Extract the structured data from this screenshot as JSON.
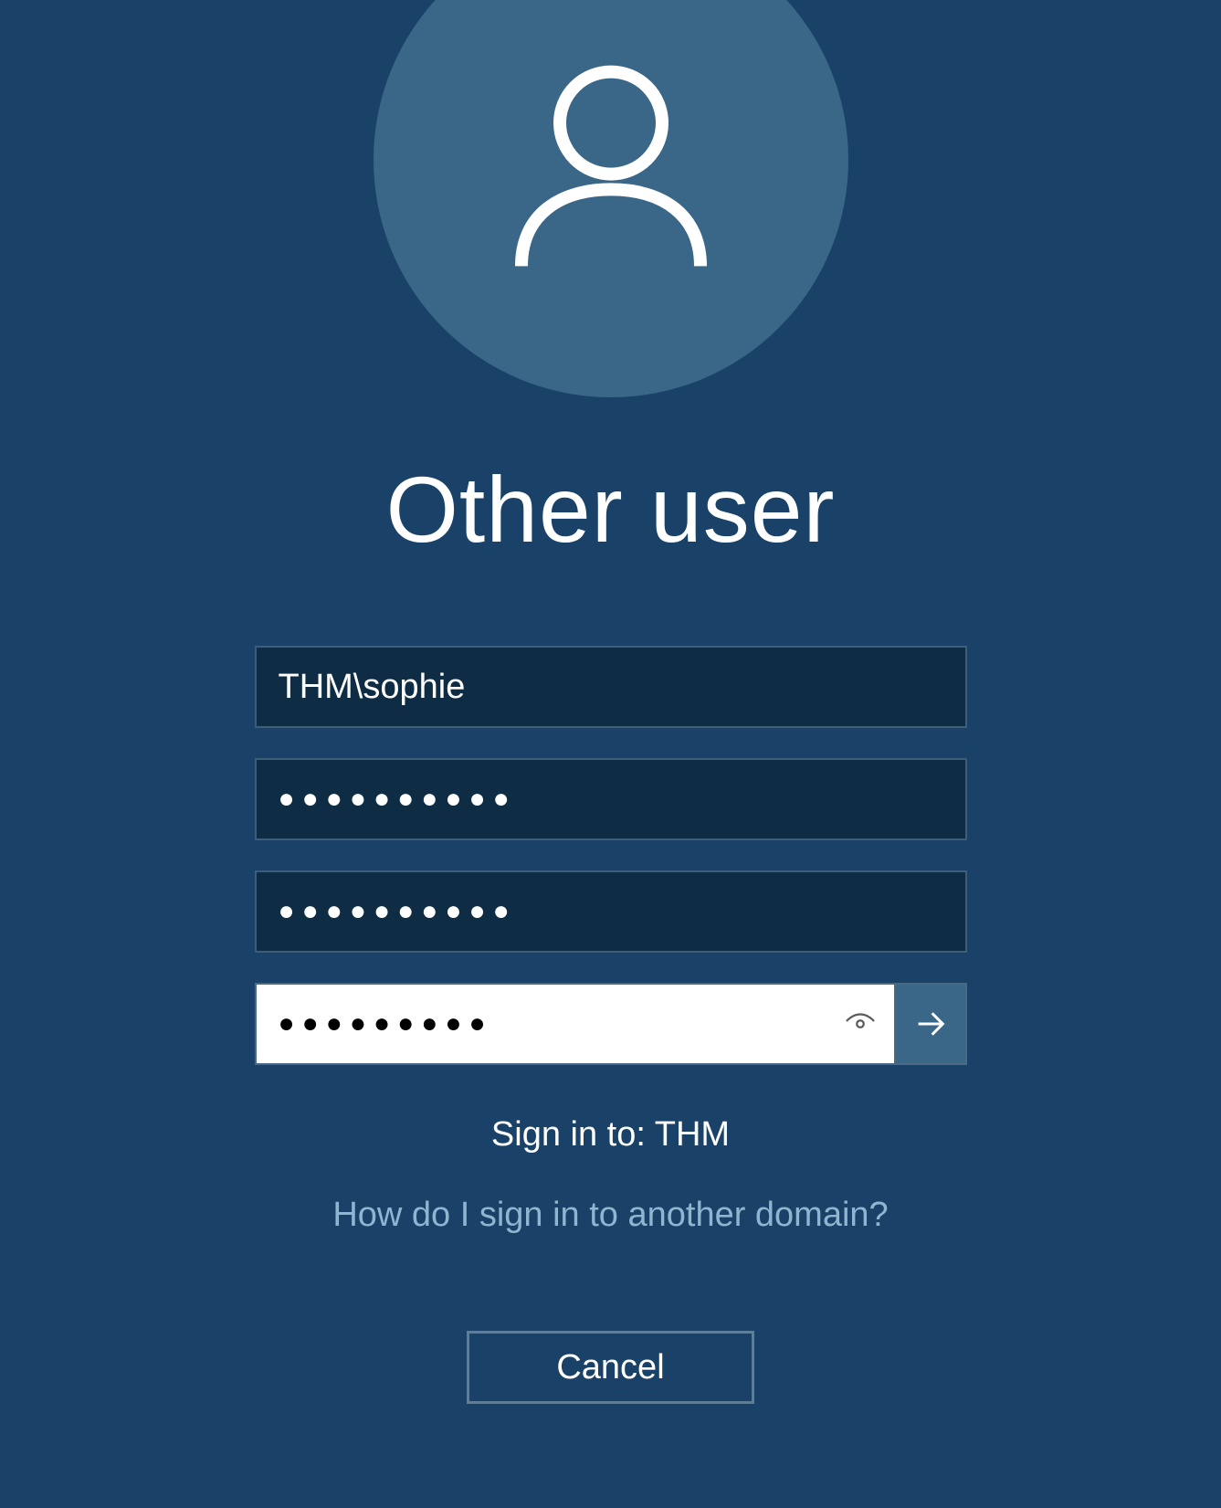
{
  "login": {
    "title": "Other user",
    "username_value": "THM\\sophie",
    "password1_value": "●●●●●●●●●●",
    "password2_value": "●●●●●●●●●●",
    "password3_value": "●●●●●●●●●",
    "signin_label": "Sign in to: THM",
    "help_link": "How do I sign in to another domain?",
    "cancel_label": "Cancel"
  }
}
